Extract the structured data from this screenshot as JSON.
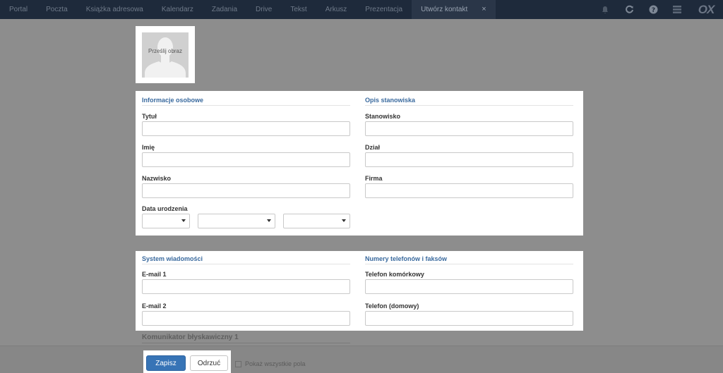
{
  "topbar": {
    "tabs": [
      "Portal",
      "Poczta",
      "Książka adresowa",
      "Kalendarz",
      "Zadania",
      "Drive",
      "Tekst",
      "Arkusz",
      "Prezentacja"
    ],
    "active_tab": "Utwórz kontakt",
    "close_glyph": "×",
    "icons": [
      "bell-icon",
      "refresh-icon",
      "help-icon",
      "menu-icon"
    ],
    "logo": "OX"
  },
  "photo": {
    "label": "Prześlij obraz"
  },
  "personal": {
    "title": "Informacje osobowe",
    "fields": [
      "Tytuł",
      "Imię",
      "Nazwisko"
    ],
    "birthdate_label": "Data urodzenia"
  },
  "job": {
    "title": "Opis stanowiska",
    "fields": [
      "Stanowisko",
      "Dział",
      "Firma"
    ]
  },
  "messaging": {
    "title": "System wiadomości",
    "fields": [
      "E-mail 1",
      "E-mail 2"
    ],
    "faded_next": "Komunikator błyskawiczny 1"
  },
  "phones": {
    "title": "Numery telefonów i faksów",
    "fields": [
      "Telefon komórkowy",
      "Telefon (domowy)"
    ]
  },
  "footer": {
    "save": "Zapisz",
    "discard": "Odrzuć",
    "show_all": "Pokaż wszystkie pola"
  }
}
